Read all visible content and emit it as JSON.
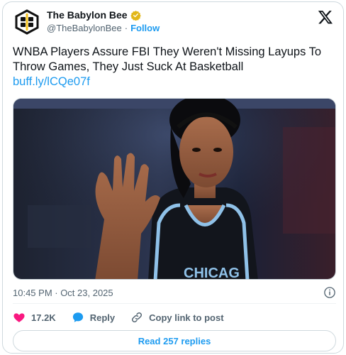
{
  "account": {
    "name": "The Babylon Bee",
    "handle": "@TheBabylonBee",
    "separator": "·",
    "follow_label": "Follow",
    "avatar_icon": "babylon-bee-logo-icon",
    "verified_icon": "gold-verified-badge-icon",
    "verified_color": "#e2b719"
  },
  "platform_icon": "x-logo-icon",
  "tweet": {
    "text": "WNBA Players Assure FBI They Weren't Missing Layups To Throw Games, They Just Suck At Basketball",
    "link": "buff.ly/lCQe07f",
    "media_description_icon": "photo-basketball-player-icon",
    "jersey_text": "CHICAG"
  },
  "meta": {
    "timestamp": "10:45 PM · Oct 23, 2025",
    "info_icon": "info-icon"
  },
  "actions": {
    "like_count": "17.2K",
    "reply_label": "Reply",
    "copy_label": "Copy link to post",
    "like_color": "#f91880",
    "reply_color": "#1d9bf0"
  },
  "read_replies_label": "Read 257 replies",
  "colors": {
    "accent": "#1d9bf0",
    "text": "#0f1419",
    "muted": "#536471"
  }
}
